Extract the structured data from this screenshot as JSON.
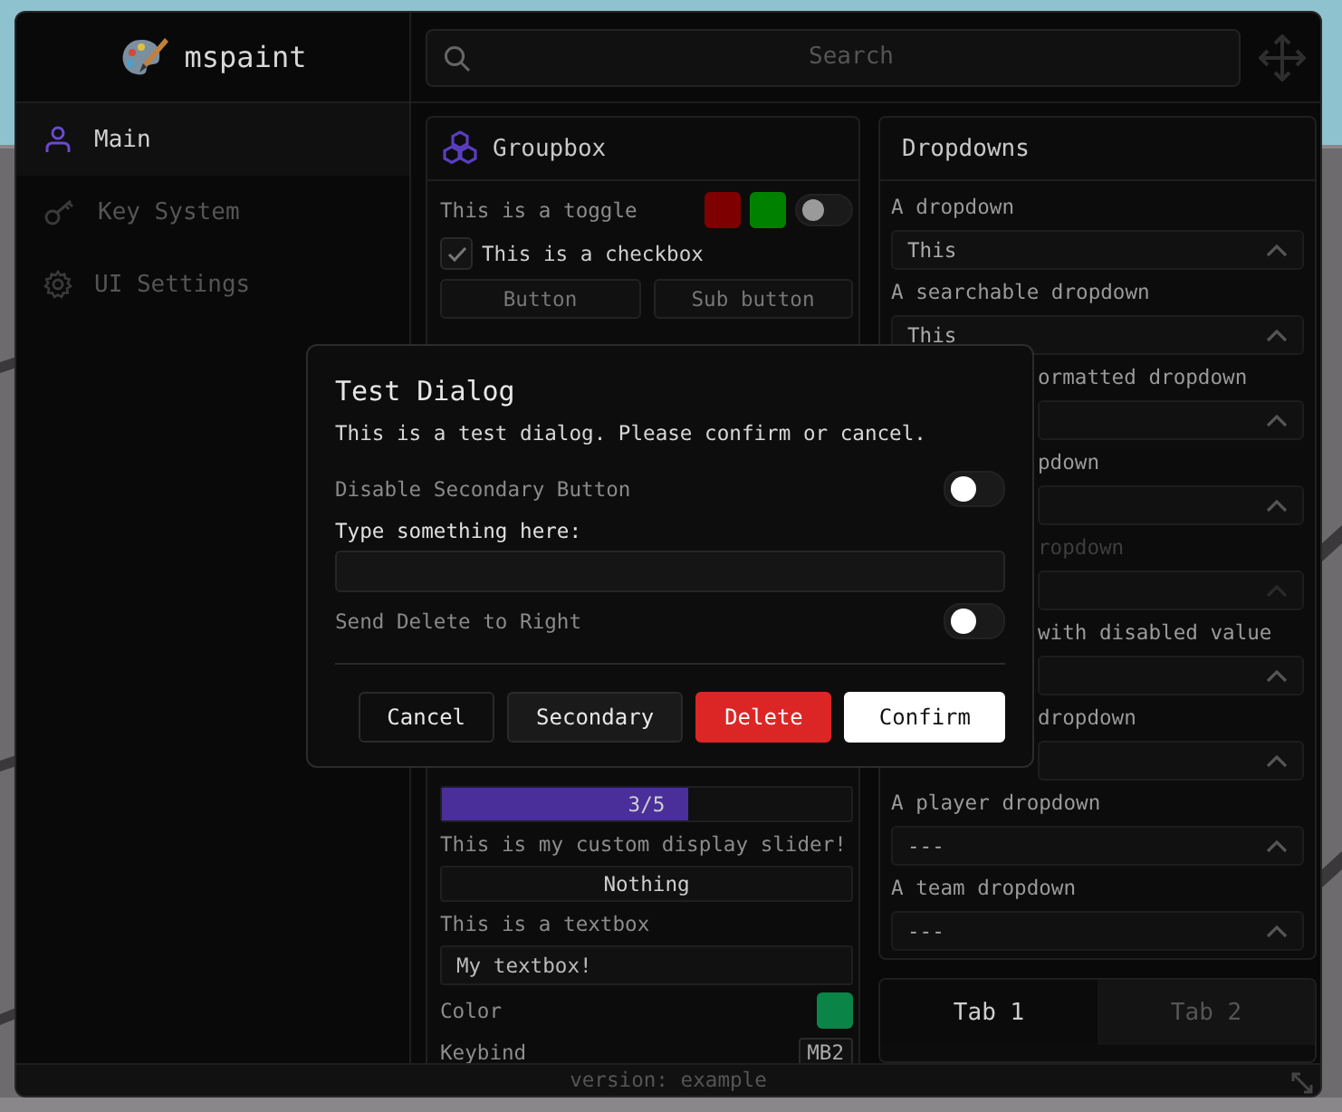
{
  "window": {
    "title": "mspaint",
    "version": "version: example"
  },
  "search": {
    "placeholder": "Search"
  },
  "sidebar": {
    "items": [
      {
        "label": "Main",
        "selected": true
      },
      {
        "label": "Key System",
        "selected": false
      },
      {
        "label": "UI Settings",
        "selected": false
      }
    ]
  },
  "groupbox": {
    "title": "Groupbox",
    "rows": [
      {
        "kind": "toggle",
        "label": "This is a toggle",
        "on": false,
        "swatches": [
          {
            "color": "#7f0000"
          },
          {
            "color": "#008200"
          }
        ]
      },
      {
        "kind": "checkbox",
        "label": "This is a checkbox",
        "checked": true
      },
      {
        "kind": "buttons",
        "buttons": [
          "Button",
          "Sub button"
        ]
      },
      {
        "kind": "gap"
      },
      {
        "kind": "slider",
        "value": "3/5",
        "level": 0.6
      },
      {
        "kind": "label",
        "label": "This is my custom display slider!"
      },
      {
        "kind": "slider",
        "value": "Nothing"
      },
      {
        "kind": "label",
        "label": "This is a textbox"
      },
      {
        "kind": "textbox",
        "value": "My textbox!"
      },
      {
        "kind": "color",
        "label": "Color",
        "color": "#0a8447"
      },
      {
        "kind": "keybind",
        "label": "Keybind",
        "key": "MB2"
      }
    ]
  },
  "dropdowns": {
    "title": "Dropdowns",
    "items": [
      {
        "label": "A dropdown",
        "value": "This",
        "covered": false,
        "disabled": false
      },
      {
        "label": "A searchable dropdown",
        "value": "This",
        "covered": false,
        "disabled": false
      },
      {
        "label": "ormatted dropdown",
        "covered": true,
        "disabled": false
      },
      {
        "label": "pdown",
        "covered": true,
        "disabled": false
      },
      {
        "label": "ropdown",
        "covered": true,
        "disabled": true
      },
      {
        "label": "with disabled value",
        "covered": true,
        "disabled": false
      },
      {
        "label": "dropdown",
        "covered": true,
        "disabled": false
      },
      {
        "label": "A player dropdown",
        "value": "---",
        "covered": false,
        "disabled": false
      },
      {
        "label": "A team dropdown",
        "value": "---",
        "covered": false,
        "disabled": false
      }
    ]
  },
  "tabbox": {
    "tabs": [
      {
        "label": "Tab 1",
        "selected": true
      },
      {
        "label": "Tab 2",
        "selected": false
      }
    ]
  },
  "dialog": {
    "title": "Test Dialog",
    "description": "This is a test dialog. Please confirm or cancel.",
    "rows": [
      {
        "kind": "toggle",
        "label": "Disable Secondary Button",
        "on": false
      },
      {
        "kind": "input",
        "label": "Type something here:"
      },
      {
        "kind": "toggle",
        "label": "Send Delete to Right",
        "on": false
      }
    ],
    "buttons": [
      {
        "label": "Cancel",
        "kind": "plain"
      },
      {
        "label": "Secondary",
        "kind": "secondary"
      },
      {
        "label": "Delete",
        "kind": "danger"
      },
      {
        "label": "Confirm",
        "kind": "primary"
      }
    ]
  }
}
